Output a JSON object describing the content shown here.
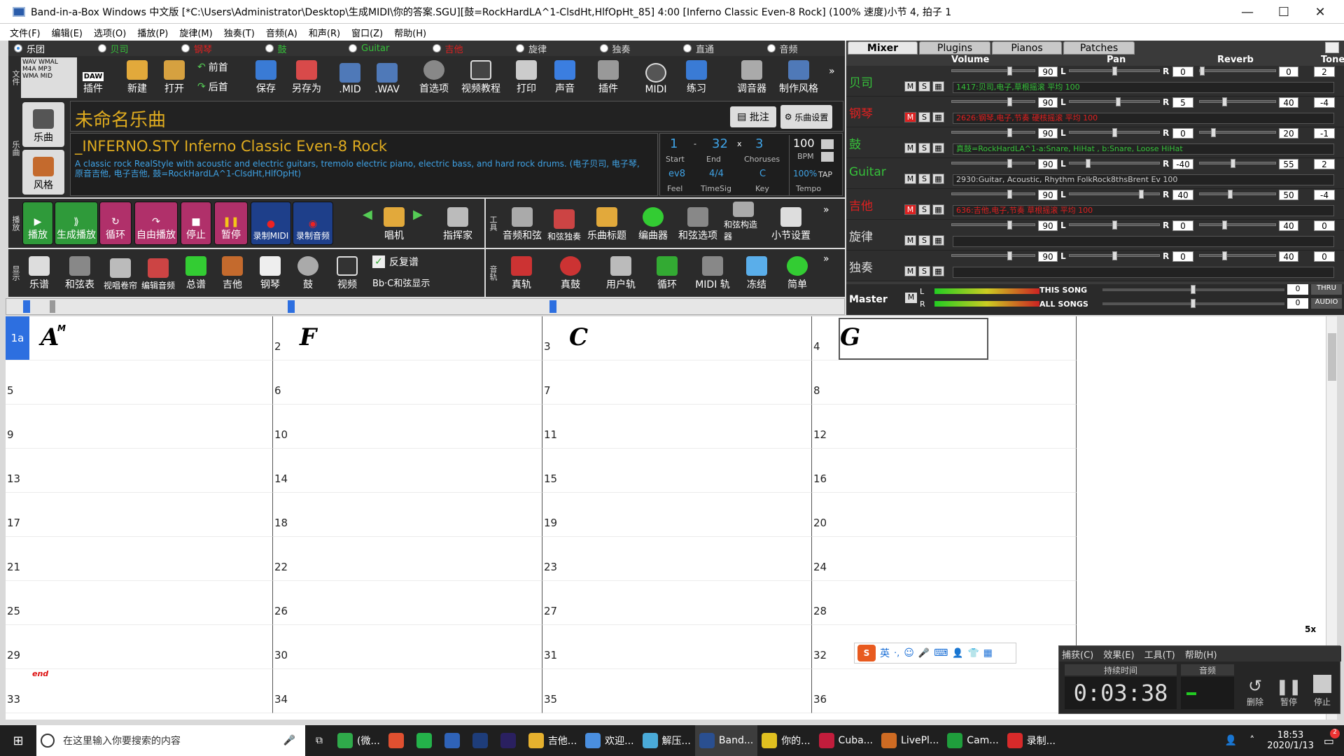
{
  "window": {
    "title": "Band-in-a-Box Windows 中文版  [*C:\\Users\\Administrator\\Desktop\\生成MIDI\\你的答案.SGU][鼓=RockHardLA^1-ClsdHt,HlfOpHt_85]   4:00  [Inferno Classic Even-8 Rock] (100% 速度)小节 4, 拍子 1",
    "min": "—",
    "max": "☐",
    "close": "✕"
  },
  "menu": [
    "文件(F)",
    "编辑(E)",
    "选项(O)",
    "播放(P)",
    "旋律(M)",
    "独奏(T)",
    "音频(A)",
    "和声(R)",
    "窗口(Z)",
    "帮助(H)"
  ],
  "tracks": [
    {
      "label": "乐团",
      "color": "#ffffff",
      "on": true
    },
    {
      "label": "贝司",
      "color": "#36c13a",
      "on": false
    },
    {
      "label": "钢琴",
      "color": "#e02020",
      "on": false
    },
    {
      "label": "鼓",
      "color": "#36c13a",
      "on": false
    },
    {
      "label": "Guitar",
      "color": "#36c13a",
      "on": false
    },
    {
      "label": "吉他",
      "color": "#e02020",
      "on": false
    },
    {
      "label": "旋律",
      "color": "#dddddd",
      "on": false
    },
    {
      "label": "独奏",
      "color": "#dddddd",
      "on": false
    },
    {
      "label": "直通",
      "color": "#dddddd",
      "on": false
    },
    {
      "label": "音频",
      "color": "#dddddd",
      "on": false
    }
  ],
  "toolbar1": {
    "section": "文件",
    "small": [
      "WAV WMAL",
      "M4A MP3",
      "WMA MID"
    ],
    "daw": "DAW",
    "plugin": "插件",
    "new": "新建",
    "open": "打开",
    "prev": "前首",
    "next": "后首",
    "save": "保存",
    "saveas": "另存为",
    "mid": ".MID",
    "wav": ".WAV",
    "prefs": "首选项",
    "video": "视频教程",
    "print": "打印",
    "sound": "声音",
    "plugins": "插件",
    "midi": "MIDI",
    "practice": "练习",
    "tuner": "调音器",
    "makestyle": "制作风格"
  },
  "song": {
    "side_label1": "乐曲",
    "side_label2": "风格",
    "side_section": "乐曲",
    "title": "未命名乐曲",
    "note_btn": "批注",
    "settings_btn": "乐曲设置",
    "style": "_INFERNO.STY Inferno Classic Even-8 Rock",
    "desc": "A classic rock RealStyle with acoustic and electric guitars, tremolo electric piano, electric bass, and hard rock drums.    (电子贝司, 电子琴, 原音吉他, 电子吉他, 鼓=RockHardLA^1-ClsdHt,HlfOpHt)",
    "start": "1",
    "end": "32",
    "x": "x",
    "choruses": "3",
    "start_l": "Start",
    "end_l": "End",
    "choruses_l": "Choruses",
    "feel": "ev8",
    "timesig": "4/4",
    "key": "C",
    "feel_l": "Feel",
    "timesig_l": "TimeSig",
    "key_l": "Key",
    "bpm": "100",
    "bpm_l": "BPM",
    "pct": "100%",
    "tempo_l": "Tempo",
    "tap": "TAP"
  },
  "play": {
    "section": "播放",
    "buttons": [
      "播放",
      "生成播放",
      "循环",
      "自由播放",
      "停止",
      "暂停",
      "录制MIDI",
      "录制音频"
    ],
    "singer": "唱机",
    "conductor": "指挥家"
  },
  "tools": {
    "section": "工具",
    "buttons": [
      "音频和弦",
      "和弦独奏",
      "乐曲标题",
      "编曲器",
      "和弦选项",
      "和弦构造器",
      "小节设置"
    ]
  },
  "display": {
    "section": "显示",
    "buttons": [
      "乐谱",
      "和弦表",
      "视唱卷帘",
      "编辑音频",
      "总谱",
      "吉他",
      "钢琴",
      "鼓",
      "视频"
    ],
    "repeat": "反复谱",
    "chorddisp": "Bb·C和弦显示"
  },
  "track_tools": {
    "section": "音轨",
    "buttons": [
      "真轨",
      "真鼓",
      "用户轨",
      "循环",
      "MIDI 轨",
      "冻结",
      "简单"
    ]
  },
  "mixer": {
    "tabs": [
      "Mixer",
      "Plugins",
      "Pianos",
      "Patches"
    ],
    "headers": [
      "Volume",
      "Pan",
      "Reverb",
      "Tone"
    ],
    "rows": [
      {
        "name": "贝司",
        "color": "#36c13a",
        "vol": "90",
        "pan": "0",
        "rev": "0",
        "tone": "2",
        "patch": "1417:贝司,电子,草根摇滚 平均 100",
        "pcolor": "#36c13a",
        "mute": false
      },
      {
        "name": "钢琴",
        "color": "#e02020",
        "vol": "90",
        "pan": "5",
        "rev": "40",
        "tone": "-4",
        "patch": "2626:钢琴,电子,节奏 硬核摇滚 平均 100",
        "pcolor": "#e02020",
        "mute": true
      },
      {
        "name": "鼓",
        "color": "#36c13a",
        "vol": "90",
        "pan": "0",
        "rev": "20",
        "tone": "-1",
        "patch": "真鼓=RockHardLA^1-a:Snare, HiHat , b:Snare, Loose HiHat",
        "pcolor": "#36c13a",
        "mute": false
      },
      {
        "name": "Guitar",
        "color": "#36c13a",
        "vol": "90",
        "pan": "-40",
        "rev": "55",
        "tone": "2",
        "patch": "2930:Guitar, Acoustic, Rhythm FolkRock8thsBrent Ev 100",
        "pcolor": "#cccccc",
        "mute": false
      },
      {
        "name": "吉他",
        "color": "#e02020",
        "vol": "90",
        "pan": "40",
        "rev": "50",
        "tone": "-4",
        "patch": "636:吉他,电子,节奏 草根摇滚 平均 100",
        "pcolor": "#e02020",
        "mute": true
      },
      {
        "name": "旋律",
        "color": "#dddddd",
        "vol": "90",
        "pan": "0",
        "rev": "40",
        "tone": "0",
        "patch": "",
        "pcolor": "#ccc",
        "mute": false
      },
      {
        "name": "独奏",
        "color": "#dddddd",
        "vol": "90",
        "pan": "0",
        "rev": "40",
        "tone": "0",
        "patch": "",
        "pcolor": "#ccc",
        "mute": false
      }
    ],
    "master": "Master",
    "this_song": "THIS SONG",
    "all_songs": "ALL SONGS",
    "thru": "THRU",
    "audio": "AUDIO",
    "m0": "0",
    "m1": "0"
  },
  "sheet": {
    "cells": [
      "1a",
      "2",
      "3",
      "4",
      "5",
      "6",
      "7",
      "8",
      "9",
      "10",
      "11",
      "12",
      "13",
      "14",
      "15",
      "16",
      "17",
      "18",
      "19",
      "20",
      "21",
      "22",
      "23",
      "24",
      "25",
      "26",
      "27",
      "28",
      "29",
      "30",
      "31",
      "32",
      "33",
      "34",
      "35",
      "36"
    ],
    "chords": {
      "0": "A",
      "1": "F",
      "2": "C",
      "3": "G"
    },
    "sup": "M",
    "end": "end",
    "zoom": "5x"
  },
  "ime": {
    "labels": [
      "英",
      "·,",
      "☺",
      "🎤",
      "⌨",
      "👤",
      "👕",
      "▦"
    ]
  },
  "recorder": {
    "menu": [
      "捕获(C)",
      "效果(E)",
      "工具(T)",
      "帮助(H)"
    ],
    "dur_label": "持续时间",
    "audio_label": "音频",
    "time": "0:03:38",
    "delete": "删除",
    "pause": "暂停",
    "stop": "停止"
  },
  "taskbar": {
    "search": "在这里输入你要搜索的内容",
    "apps": [
      "(微...",
      "",
      "",
      "",
      "",
      "",
      "吉他...",
      "欢迎...",
      "解压...",
      "Band...",
      "你的...",
      "Cuba...",
      "LivePl...",
      "Cam...",
      "录制..."
    ],
    "time": "18:53",
    "date": "2020/1/13",
    "badge": "2"
  }
}
